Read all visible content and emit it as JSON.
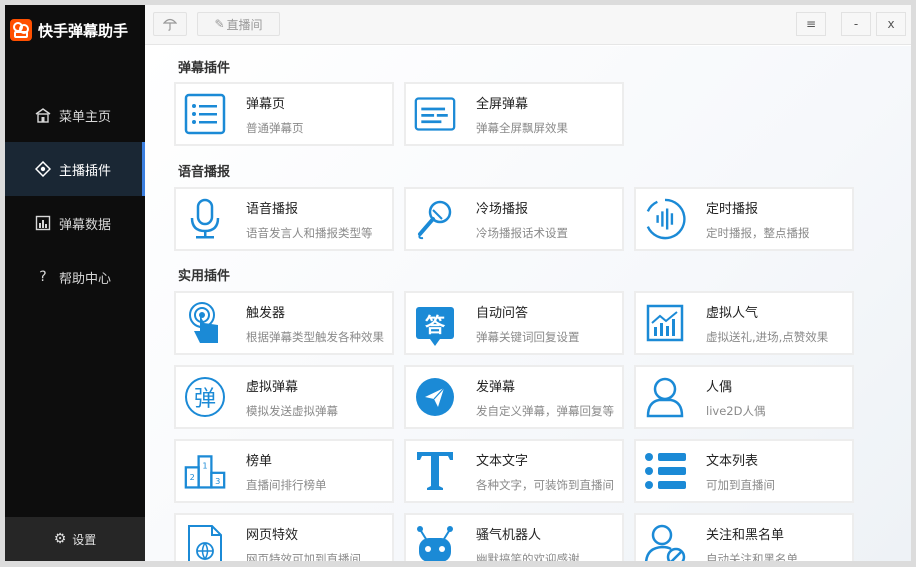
{
  "app": {
    "title": "快手弹幕助手"
  },
  "colors": {
    "accent": "#1b8ad6",
    "sidebar_bg": "#0d0d0d",
    "brand": "#ff5000",
    "active_bar": "#3b7fe0"
  },
  "sidebar": {
    "items": [
      {
        "label": "菜单主页",
        "icon": "home-icon"
      },
      {
        "label": "主播插件",
        "icon": "plugin-icon",
        "active": true
      },
      {
        "label": "弹幕数据",
        "icon": "bar-chart-icon"
      },
      {
        "label": "帮助中心",
        "icon": "question-icon"
      }
    ],
    "settings_label": "设置"
  },
  "topbar": {
    "pin_icon": "umbrella-icon",
    "live_label": "直播间",
    "menu_icon": "≡",
    "minimize": "-",
    "close": "x"
  },
  "sections": [
    {
      "title": "弹幕插件",
      "cards": [
        {
          "title": "弹幕页",
          "desc": "普通弹幕页",
          "icon": "list-page-icon"
        },
        {
          "title": "全屏弹幕",
          "desc": "弹幕全屏飘屏效果",
          "icon": "fullscreen-danmaku-icon"
        }
      ]
    },
    {
      "title": "语音播报",
      "cards": [
        {
          "title": "语音播报",
          "desc": "语音发言人和播报类型等",
          "icon": "microphone-icon"
        },
        {
          "title": "冷场播报",
          "desc": "冷场播报话术设置",
          "icon": "karaoke-mic-icon"
        },
        {
          "title": "定时播报",
          "desc": "定时播报，整点播报",
          "icon": "voice-wave-icon"
        }
      ]
    },
    {
      "title": "实用插件",
      "cards": [
        {
          "title": "触发器",
          "desc": "根据弹幕类型触发各种效果",
          "icon": "touch-trigger-icon"
        },
        {
          "title": "自动问答",
          "desc": "弹幕关键词回复设置",
          "icon": "answer-icon"
        },
        {
          "title": "虚拟人气",
          "desc": "虚拟送礼,进场,点赞效果",
          "icon": "trend-chart-icon"
        },
        {
          "title": "虚拟弹幕",
          "desc": "模拟发送虚拟弹幕",
          "icon": "danmaku-char-icon"
        },
        {
          "title": "发弹幕",
          "desc": "发自定义弹幕，弹幕回复等",
          "icon": "send-icon"
        },
        {
          "title": "人偶",
          "desc": "live2D人偶",
          "icon": "person-icon"
        },
        {
          "title": "榜单",
          "desc": "直播间排行榜单",
          "icon": "podium-icon"
        },
        {
          "title": "文本文字",
          "desc": "各种文字，可装饰到直播间",
          "icon": "text-t-icon"
        },
        {
          "title": "文本列表",
          "desc": "可加到直播间",
          "icon": "text-list-icon"
        },
        {
          "title": "网页特效",
          "desc": "网页特效可加到直播间",
          "icon": "web-page-icon"
        },
        {
          "title": "骚气机器人",
          "desc": "幽默搞笑的欢迎感谢",
          "icon": "robot-icon"
        },
        {
          "title": "关注和黑名单",
          "desc": "自动关注和黑名单",
          "icon": "user-block-icon"
        }
      ]
    }
  ]
}
